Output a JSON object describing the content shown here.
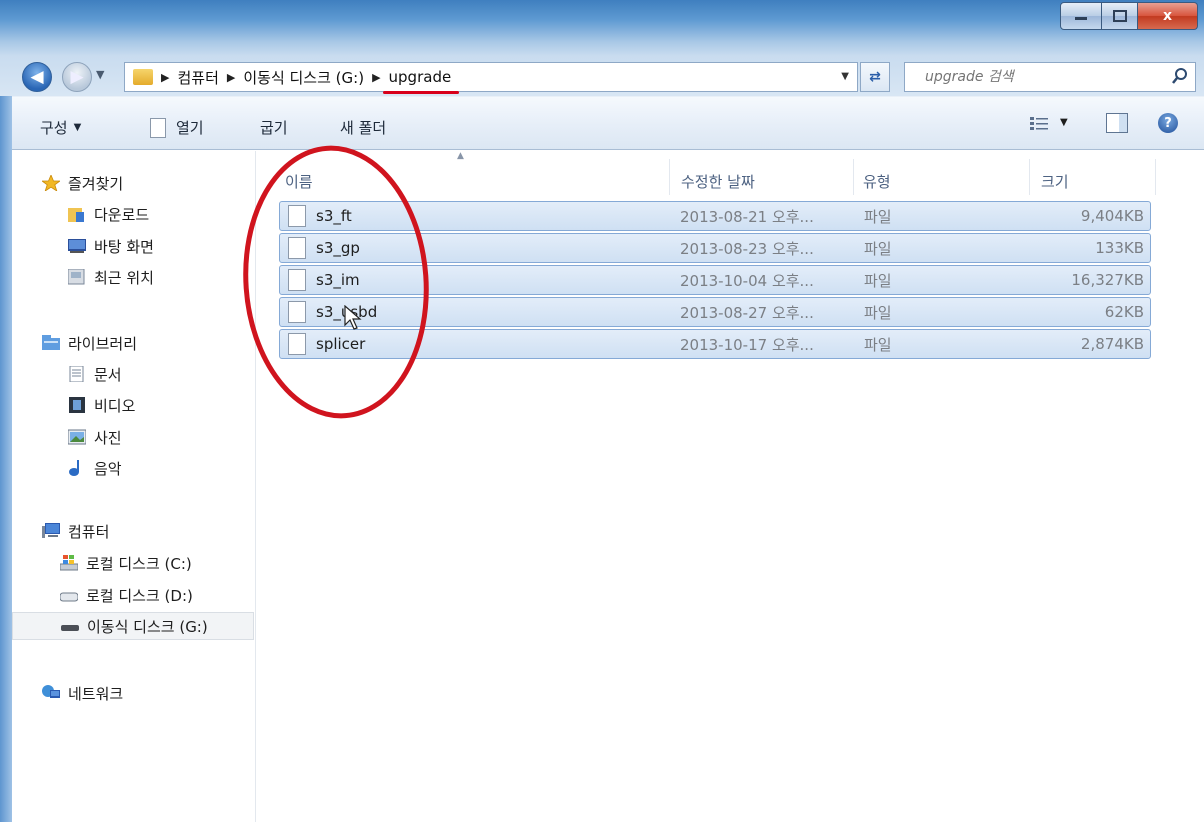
{
  "window": {
    "controls": {
      "minimize": "",
      "maximize": "",
      "close": "x"
    }
  },
  "address": {
    "crumbs": [
      "컴퓨터",
      "이동식 디스크 (G:)",
      "upgrade"
    ],
    "search_placeholder": "upgrade 검색",
    "accent_underline": "#d8001a"
  },
  "toolbar": {
    "organize": "구성",
    "open": "열기",
    "burn": "굽기",
    "new_folder": "새 폴더"
  },
  "sidebar": {
    "favorites": {
      "label": "즐겨찾기",
      "items": [
        "다운로드",
        "바탕 화면",
        "최근 위치"
      ]
    },
    "libraries": {
      "label": "라이브러리",
      "items": [
        "문서",
        "비디오",
        "사진",
        "음악"
      ]
    },
    "computer": {
      "label": "컴퓨터",
      "items": [
        "로컬 디스크 (C:)",
        "로컬 디스크 (D:)",
        "이동식 디스크 (G:)"
      ]
    },
    "network": {
      "label": "네트워크"
    }
  },
  "columns": {
    "name": "이름",
    "date": "수정한 날짜",
    "type": "유형",
    "size": "크기"
  },
  "files": [
    {
      "name": "s3_ft",
      "date": "2013-08-21 오후...",
      "type": "파일",
      "size": "9,404KB"
    },
    {
      "name": "s3_gp",
      "date": "2013-08-23 오후...",
      "type": "파일",
      "size": "133KB"
    },
    {
      "name": "s3_im",
      "date": "2013-10-04 오후...",
      "type": "파일",
      "size": "16,327KB"
    },
    {
      "name": "s3_usbd",
      "date": "2013-08-27 오후...",
      "type": "파일",
      "size": "62KB"
    },
    {
      "name": "splicer",
      "date": "2013-10-17 오후...",
      "type": "파일",
      "size": "2,874KB"
    }
  ],
  "annotation": {
    "circle_color": "#d0141e"
  }
}
